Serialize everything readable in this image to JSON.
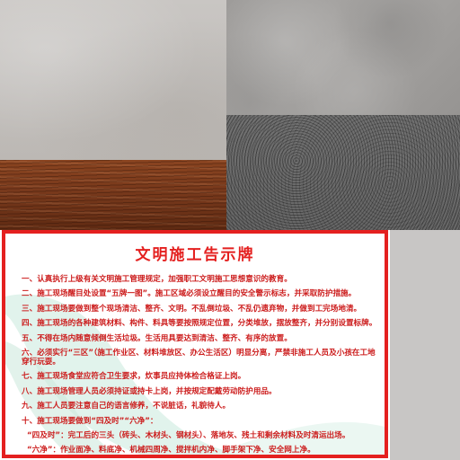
{
  "board": {
    "title": "文明施工告示牌",
    "rules": [
      "一、认真执行上级有关文明施工管理规定，加强职工文明施工思想意识的教育。",
      "二、施工现场醒目处设置“五牌一图”。施工区域必须设立醒目的安全警示标志，并采取防护措施。",
      "三、施工现场要做到整个现场清洁、整齐、文明。不乱倒垃圾、不乱仍遗弃物，并做到工完场地清。",
      "四、施工现场的各种建筑材料、构件、料具等要按照规定位置，分类堆放，摆放整齐，并分别设置标牌。",
      "五、不得在场内随意倾倒生活垃圾。生活用具要达到清洁、整齐、有序的放置。",
      "六、必须实行“三区”（施工作业区、材料堆放区、办公生活区）明显分离，严禁非施工人员及小孩在工地穿行玩耍。",
      "七、施工现场食堂应符合卫生要求，炊事员应持体检合格证上岗。",
      "八、施工现场管理人员必须持证或持卡上岗，并按规定配戴劳动防护用品。",
      "九、施工人员要注意自己的语言修养，不说脏话，礼貌待人。",
      "十、施工现场要做到“四及时”“六净”：",
      "“四及时”：完工后的三头（砖头、木材头、钢材头）、落地灰、残土和剩余材料及时清运出场。",
      "“六净”：作业面净、料底净、机械四周净、搅拌机内净、脚手架下净、安全网上净。"
    ]
  },
  "colors": {
    "border": "#e4201f",
    "text": "#cc1c1c",
    "decor": "#d7efe6"
  }
}
